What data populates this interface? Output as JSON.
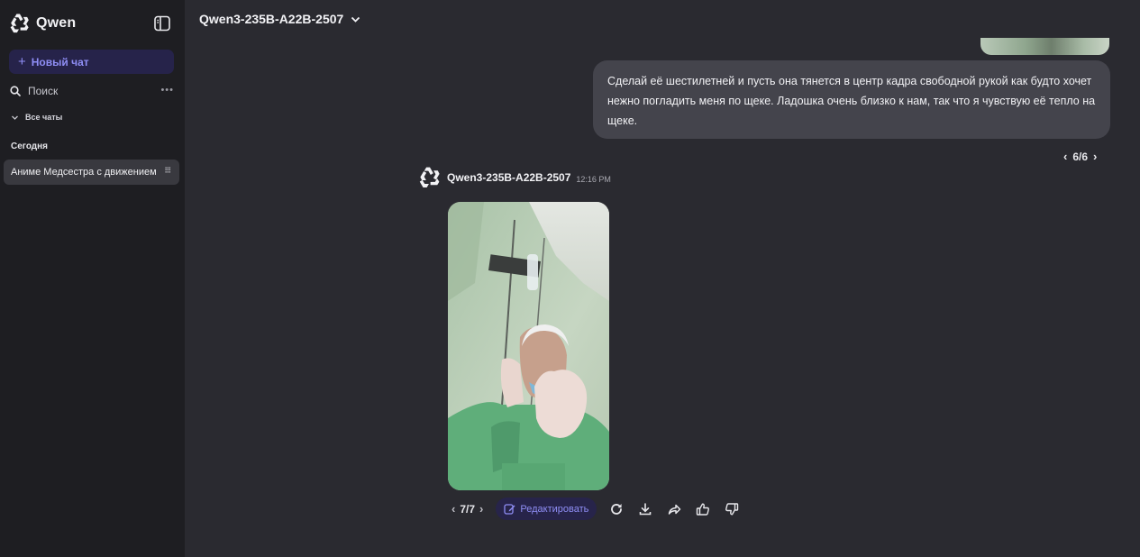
{
  "sidebar": {
    "brand": "Qwen",
    "new_chat": "Новый чат",
    "search": "Поиск",
    "all_chats": "Все чаты",
    "section_today": "Сегодня",
    "chats": [
      {
        "title": "Аниме Медсестра с движением"
      }
    ]
  },
  "header": {
    "model": "Qwen3-235B-A22B-2507"
  },
  "conversation": {
    "user_message": "Сделай её шестилетней и пусть она тянется в центр кадра свободной рукой как будто хочет нежно погладить меня по щеке. Ладошка очень близко к нам, так что я чувствую её тепло на щеке.",
    "user_pager": "6/6",
    "assistant": {
      "name": "Qwen3-235B-A22B-2507",
      "time": "12:16 PM",
      "pager": "7/7",
      "edit_label": "Редактировать"
    }
  },
  "colors": {
    "sidebar_bg": "#1e1e22",
    "main_bg": "#2a2a30",
    "accent": "#8f8ef5",
    "user_bubble": "#44444c"
  }
}
